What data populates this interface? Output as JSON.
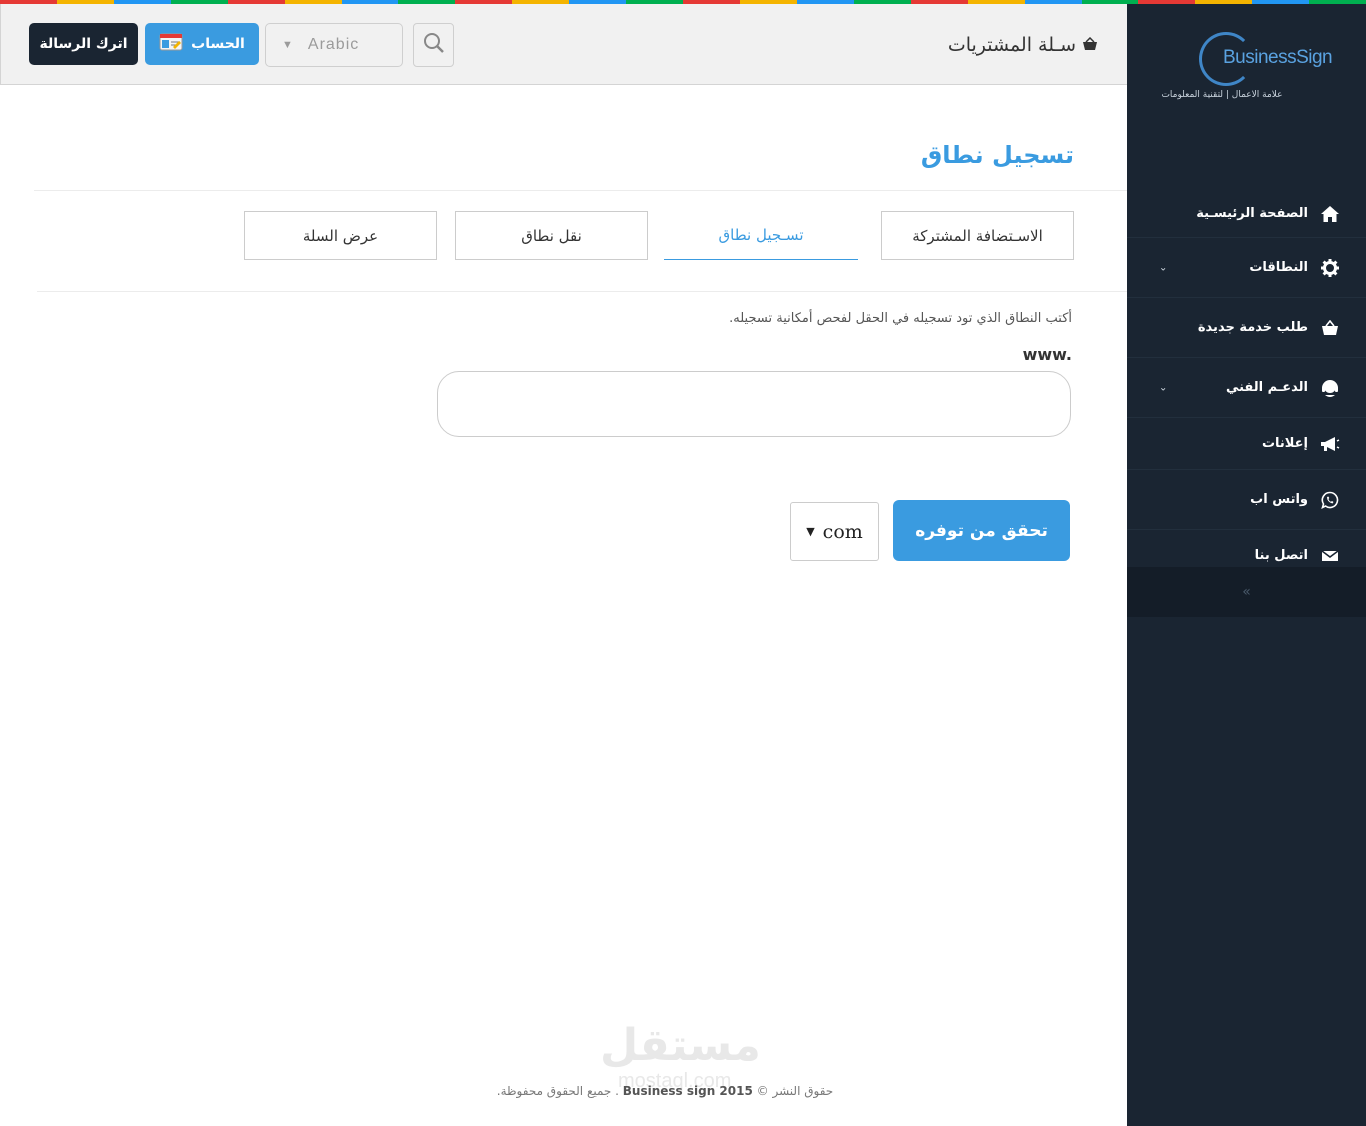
{
  "colors": {
    "accent": "#3a9be0",
    "sidebar_bg": "#1a2532",
    "rainbow": [
      "#e53935",
      "#f4b400",
      "#2196f3",
      "#00b050",
      "#e53935",
      "#f4b400",
      "#2196f3",
      "#00b050",
      "#e53935",
      "#f4b400",
      "#2196f3",
      "#00b050",
      "#e53935",
      "#f4b400",
      "#2196f3",
      "#00b050",
      "#e53935",
      "#f4b400",
      "#2196f3",
      "#00b050",
      "#e53935",
      "#f4b400",
      "#2196f3",
      "#00b050"
    ]
  },
  "sidebar": {
    "logo_text": "BusinessSign",
    "logo_tagline": "علامة الاعمال | لتقنية المعلومات",
    "items": [
      {
        "label": "الصفحة الرئيسـية",
        "icon": "home-icon"
      },
      {
        "label": "النطاقات",
        "icon": "gear-icon",
        "has_submenu": true
      },
      {
        "label": "طلب خدمة جديدة",
        "icon": "basket-icon"
      },
      {
        "label": "الدعـم الفني",
        "icon": "headset-icon",
        "has_submenu": true
      },
      {
        "label": "إعلانات",
        "icon": "megaphone-icon"
      },
      {
        "label": "واتس اب",
        "icon": "whatsapp-icon"
      },
      {
        "label": "اتصل بنا",
        "icon": "envelope-icon"
      }
    ],
    "collapse_glyph": "«"
  },
  "header": {
    "cart_label": "سـلة المشتريات",
    "leave_message_label": "اترك الرسالة",
    "account_label": "الحساب",
    "language": "Arabic"
  },
  "main": {
    "title": "تسجيل نطاق",
    "tabs": [
      {
        "label": "الاسـتضافة المشتركة",
        "active": false
      },
      {
        "label": "تسـجيل نطاق",
        "active": true
      },
      {
        "label": "نقل نطاق",
        "active": false
      },
      {
        "label": "عرض السلة",
        "active": false
      }
    ],
    "instructions": "أكتب النطاق الذي تود تسجيله في الحقل لفحص أمكانية تسجيله.",
    "www_prefix": "www.",
    "domain_value": "",
    "check_button": "تحقق من توفره",
    "tld_selected": "com"
  },
  "footer": {
    "text_before": "حقوق النشر ©",
    "brand": "Business sign 2015",
    "text_after": ". جميع الحقوق محفوظة."
  },
  "watermark": {
    "text": "مستقل",
    "sub": "mostaql.com"
  }
}
